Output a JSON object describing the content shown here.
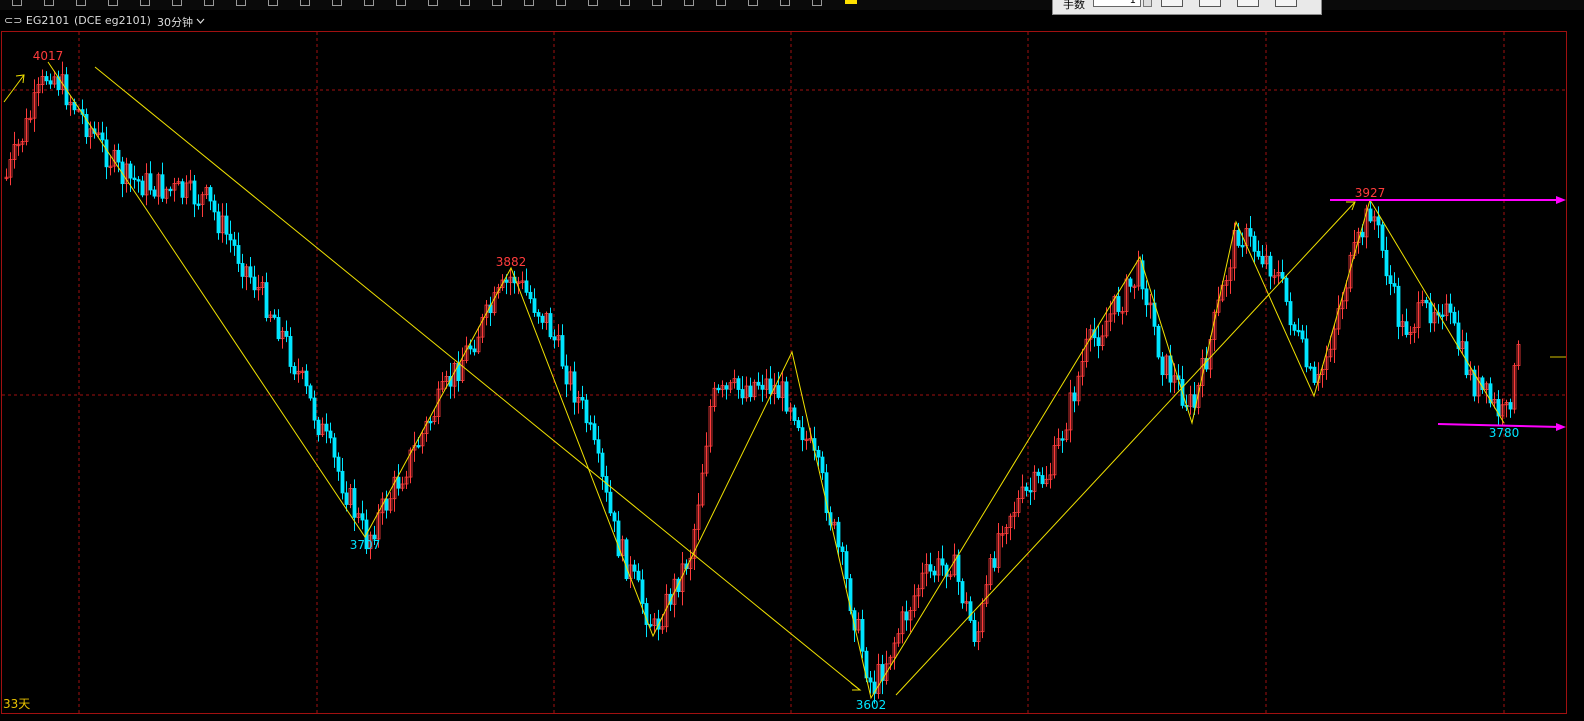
{
  "header": {
    "symbol": "⊂⊃ EG2101",
    "contract": "(DCE eg2101)",
    "period": "30分钟",
    "period_icon": "chevron-down-icon"
  },
  "toolbar": {
    "quantity_label": "手数",
    "quantity_value": "1"
  },
  "chart": {
    "bottom_left_label": "33天",
    "colors": {
      "up": "#ff3c3c",
      "down": "#00e5ff",
      "zigzag": "#f0e100",
      "arrow": "#ff00ff",
      "grid": "#a01010",
      "high_label": "#ff3c3c",
      "low_label": "#00e5ff"
    },
    "pivot_labels": [
      {
        "text": "4017",
        "kind": "high"
      },
      {
        "text": "3707",
        "kind": "low"
      },
      {
        "text": "3882",
        "kind": "high"
      },
      {
        "text": "3602",
        "kind": "low"
      },
      {
        "text": "3927",
        "kind": "high"
      },
      {
        "text": "3780",
        "kind": "low"
      }
    ]
  }
}
